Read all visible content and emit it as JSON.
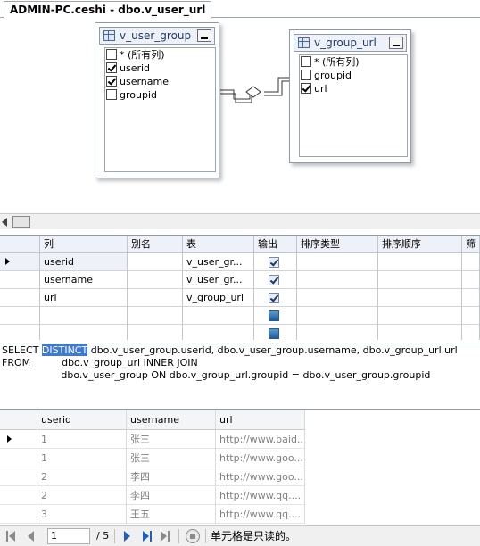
{
  "tab": {
    "title": "ADMIN-PC.ceshi - dbo.v_user_url"
  },
  "diagram": {
    "tables": [
      {
        "name": "v_user_group",
        "columns": [
          {
            "label": "* (所有列)",
            "checked": false
          },
          {
            "label": "userid",
            "checked": true
          },
          {
            "label": "username",
            "checked": true
          },
          {
            "label": "groupid",
            "checked": false
          }
        ]
      },
      {
        "name": "v_group_url",
        "columns": [
          {
            "label": "* (所有列)",
            "checked": false
          },
          {
            "label": "groupid",
            "checked": false
          },
          {
            "label": "url",
            "checked": true
          }
        ]
      }
    ]
  },
  "criteria": {
    "headers": [
      "列",
      "别名",
      "表",
      "输出",
      "排序类型",
      "排序顺序",
      "筛"
    ],
    "rows": [
      {
        "column": "userid",
        "alias": "",
        "table": "v_user_gr...",
        "output": true
      },
      {
        "column": "username",
        "alias": "",
        "table": "v_user_gr...",
        "output": true
      },
      {
        "column": "url",
        "alias": "",
        "table": "v_group_url",
        "output": true
      },
      {
        "column": "",
        "alias": "",
        "table": "",
        "output": null
      },
      {
        "column": "",
        "alias": "",
        "table": "",
        "output": null
      }
    ]
  },
  "sql": {
    "line1_kw": "SELECT ",
    "line1_highlight": "DISTINCT",
    "line1_rest": " dbo.v_user_group.userid, dbo.v_user_group.username, dbo.v_group_url.url",
    "line2": "FROM          dbo.v_group_url INNER JOIN",
    "line3": "                   dbo.v_user_group ON dbo.v_group_url.groupid = dbo.v_user_group.groupid"
  },
  "results": {
    "headers": [
      "userid",
      "username",
      "url"
    ],
    "rows": [
      [
        "1",
        "张三",
        "http://www.baid..."
      ],
      [
        "1",
        "张三",
        "http://www.goo..."
      ],
      [
        "2",
        "李四",
        "http://www.goo..."
      ],
      [
        "2",
        "李四",
        "http://www.qq...."
      ],
      [
        "3",
        "王五",
        "http://www.qq...."
      ]
    ]
  },
  "nav": {
    "current_page": "1",
    "total": "/ 5",
    "status": "单元格是只读的。"
  }
}
